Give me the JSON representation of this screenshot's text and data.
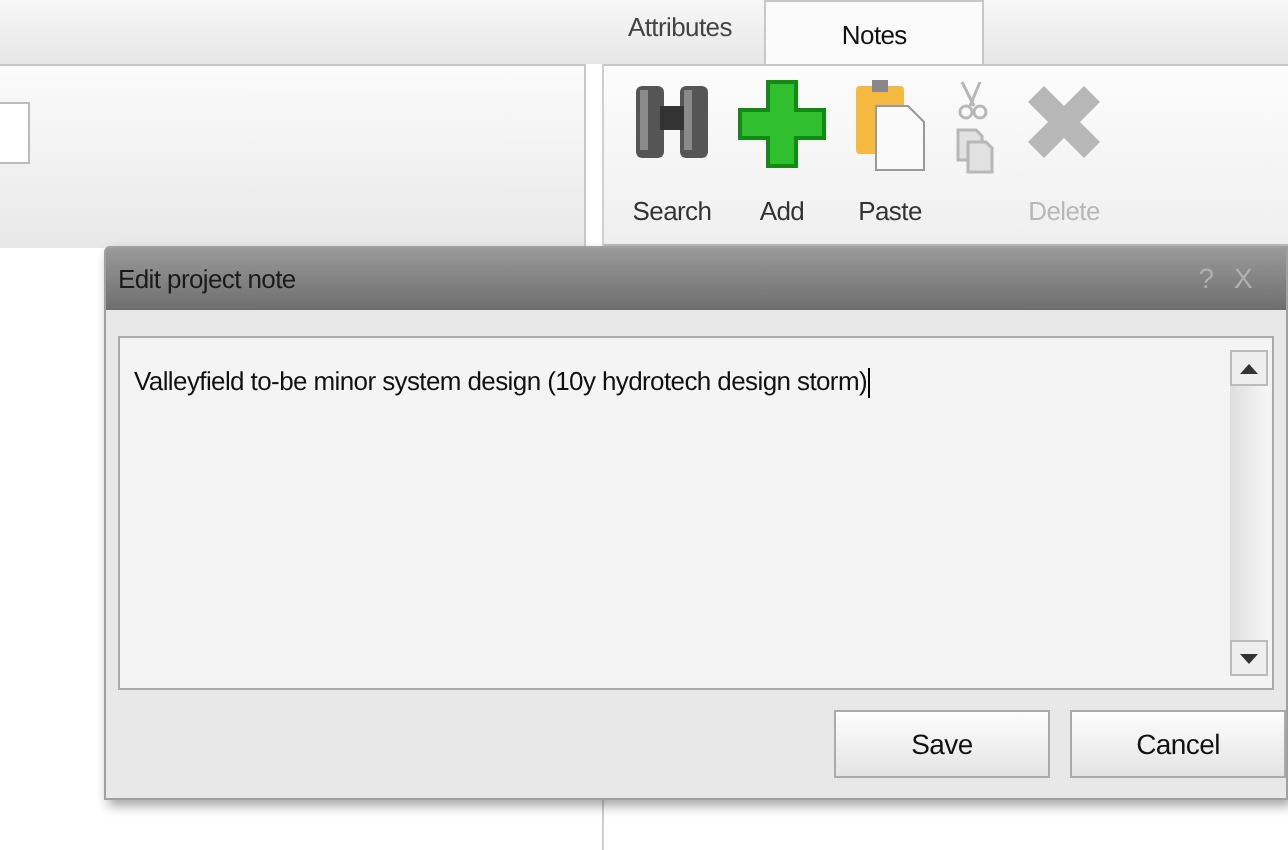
{
  "tabs": [
    {
      "label": "Attributes",
      "selected": false
    },
    {
      "label": "Notes",
      "selected": true
    }
  ],
  "toolbar": [
    {
      "kind": "search",
      "label": "Search",
      "disabled": false
    },
    {
      "kind": "add",
      "label": "Add",
      "disabled": false
    },
    {
      "kind": "paste",
      "label": "Paste",
      "disabled": false
    },
    {
      "kind": "cutcopy",
      "disabled": true
    },
    {
      "kind": "delete",
      "label": "Delete",
      "disabled": true
    }
  ],
  "dialog": {
    "title": "Edit project note",
    "help": "?",
    "close": "X",
    "note": "Valleyfield to-be minor system design (10y hydrotech design storm)",
    "buttons": [
      "Save",
      "Cancel"
    ]
  }
}
